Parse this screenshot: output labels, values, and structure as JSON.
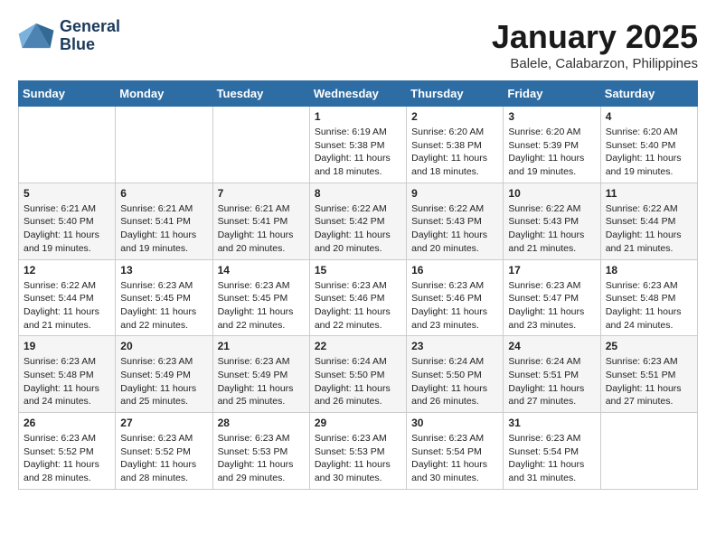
{
  "header": {
    "logo_line1": "General",
    "logo_line2": "Blue",
    "month_title": "January 2025",
    "location": "Balele, Calabarzon, Philippines"
  },
  "weekdays": [
    "Sunday",
    "Monday",
    "Tuesday",
    "Wednesday",
    "Thursday",
    "Friday",
    "Saturday"
  ],
  "weeks": [
    [
      {
        "day": "",
        "info": ""
      },
      {
        "day": "",
        "info": ""
      },
      {
        "day": "",
        "info": ""
      },
      {
        "day": "1",
        "info": "Sunrise: 6:19 AM\nSunset: 5:38 PM\nDaylight: 11 hours\nand 18 minutes."
      },
      {
        "day": "2",
        "info": "Sunrise: 6:20 AM\nSunset: 5:38 PM\nDaylight: 11 hours\nand 18 minutes."
      },
      {
        "day": "3",
        "info": "Sunrise: 6:20 AM\nSunset: 5:39 PM\nDaylight: 11 hours\nand 19 minutes."
      },
      {
        "day": "4",
        "info": "Sunrise: 6:20 AM\nSunset: 5:40 PM\nDaylight: 11 hours\nand 19 minutes."
      }
    ],
    [
      {
        "day": "5",
        "info": "Sunrise: 6:21 AM\nSunset: 5:40 PM\nDaylight: 11 hours\nand 19 minutes."
      },
      {
        "day": "6",
        "info": "Sunrise: 6:21 AM\nSunset: 5:41 PM\nDaylight: 11 hours\nand 19 minutes."
      },
      {
        "day": "7",
        "info": "Sunrise: 6:21 AM\nSunset: 5:41 PM\nDaylight: 11 hours\nand 20 minutes."
      },
      {
        "day": "8",
        "info": "Sunrise: 6:22 AM\nSunset: 5:42 PM\nDaylight: 11 hours\nand 20 minutes."
      },
      {
        "day": "9",
        "info": "Sunrise: 6:22 AM\nSunset: 5:43 PM\nDaylight: 11 hours\nand 20 minutes."
      },
      {
        "day": "10",
        "info": "Sunrise: 6:22 AM\nSunset: 5:43 PM\nDaylight: 11 hours\nand 21 minutes."
      },
      {
        "day": "11",
        "info": "Sunrise: 6:22 AM\nSunset: 5:44 PM\nDaylight: 11 hours\nand 21 minutes."
      }
    ],
    [
      {
        "day": "12",
        "info": "Sunrise: 6:22 AM\nSunset: 5:44 PM\nDaylight: 11 hours\nand 21 minutes."
      },
      {
        "day": "13",
        "info": "Sunrise: 6:23 AM\nSunset: 5:45 PM\nDaylight: 11 hours\nand 22 minutes."
      },
      {
        "day": "14",
        "info": "Sunrise: 6:23 AM\nSunset: 5:45 PM\nDaylight: 11 hours\nand 22 minutes."
      },
      {
        "day": "15",
        "info": "Sunrise: 6:23 AM\nSunset: 5:46 PM\nDaylight: 11 hours\nand 22 minutes."
      },
      {
        "day": "16",
        "info": "Sunrise: 6:23 AM\nSunset: 5:46 PM\nDaylight: 11 hours\nand 23 minutes."
      },
      {
        "day": "17",
        "info": "Sunrise: 6:23 AM\nSunset: 5:47 PM\nDaylight: 11 hours\nand 23 minutes."
      },
      {
        "day": "18",
        "info": "Sunrise: 6:23 AM\nSunset: 5:48 PM\nDaylight: 11 hours\nand 24 minutes."
      }
    ],
    [
      {
        "day": "19",
        "info": "Sunrise: 6:23 AM\nSunset: 5:48 PM\nDaylight: 11 hours\nand 24 minutes."
      },
      {
        "day": "20",
        "info": "Sunrise: 6:23 AM\nSunset: 5:49 PM\nDaylight: 11 hours\nand 25 minutes."
      },
      {
        "day": "21",
        "info": "Sunrise: 6:23 AM\nSunset: 5:49 PM\nDaylight: 11 hours\nand 25 minutes."
      },
      {
        "day": "22",
        "info": "Sunrise: 6:24 AM\nSunset: 5:50 PM\nDaylight: 11 hours\nand 26 minutes."
      },
      {
        "day": "23",
        "info": "Sunrise: 6:24 AM\nSunset: 5:50 PM\nDaylight: 11 hours\nand 26 minutes."
      },
      {
        "day": "24",
        "info": "Sunrise: 6:24 AM\nSunset: 5:51 PM\nDaylight: 11 hours\nand 27 minutes."
      },
      {
        "day": "25",
        "info": "Sunrise: 6:23 AM\nSunset: 5:51 PM\nDaylight: 11 hours\nand 27 minutes."
      }
    ],
    [
      {
        "day": "26",
        "info": "Sunrise: 6:23 AM\nSunset: 5:52 PM\nDaylight: 11 hours\nand 28 minutes."
      },
      {
        "day": "27",
        "info": "Sunrise: 6:23 AM\nSunset: 5:52 PM\nDaylight: 11 hours\nand 28 minutes."
      },
      {
        "day": "28",
        "info": "Sunrise: 6:23 AM\nSunset: 5:53 PM\nDaylight: 11 hours\nand 29 minutes."
      },
      {
        "day": "29",
        "info": "Sunrise: 6:23 AM\nSunset: 5:53 PM\nDaylight: 11 hours\nand 30 minutes."
      },
      {
        "day": "30",
        "info": "Sunrise: 6:23 AM\nSunset: 5:54 PM\nDaylight: 11 hours\nand 30 minutes."
      },
      {
        "day": "31",
        "info": "Sunrise: 6:23 AM\nSunset: 5:54 PM\nDaylight: 11 hours\nand 31 minutes."
      },
      {
        "day": "",
        "info": ""
      }
    ]
  ]
}
